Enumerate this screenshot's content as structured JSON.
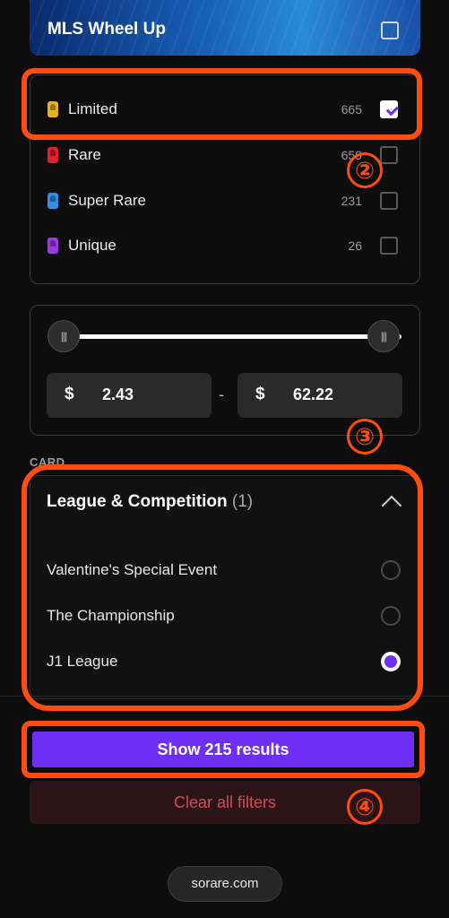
{
  "top_card": {
    "title": "MLS Wheel Up",
    "checked": false
  },
  "rarities": [
    {
      "label": "Limited",
      "count": "665",
      "color": "#e8b21c",
      "checked": true
    },
    {
      "label": "Rare",
      "count": "659",
      "color": "#e0202a",
      "checked": false
    },
    {
      "label": "Super Rare",
      "count": "231",
      "color": "#2f8fe8",
      "checked": false
    },
    {
      "label": "Unique",
      "count": "26",
      "color": "#9a3ae0",
      "checked": false
    }
  ],
  "price": {
    "currency": "$",
    "min": "2.43",
    "max": "62.22",
    "separator": "-",
    "handle_glyph": "|||"
  },
  "section_label": "CARD",
  "league": {
    "title": "League & Competition",
    "count": "(1)",
    "items": [
      {
        "label": "Valentine's Special Event",
        "selected": false
      },
      {
        "label": "The Championship",
        "selected": false
      },
      {
        "label": "J1 League",
        "selected": true
      }
    ]
  },
  "actions": {
    "show_results": "Show 215 results",
    "clear_filters": "Clear all filters"
  },
  "footer": {
    "site": "sorare.com"
  },
  "annotations": [
    "②",
    "③",
    "④"
  ],
  "colors": {
    "accent": "#6d2ff6",
    "highlight": "#ff4d10",
    "danger_text": "#d84a5a"
  }
}
